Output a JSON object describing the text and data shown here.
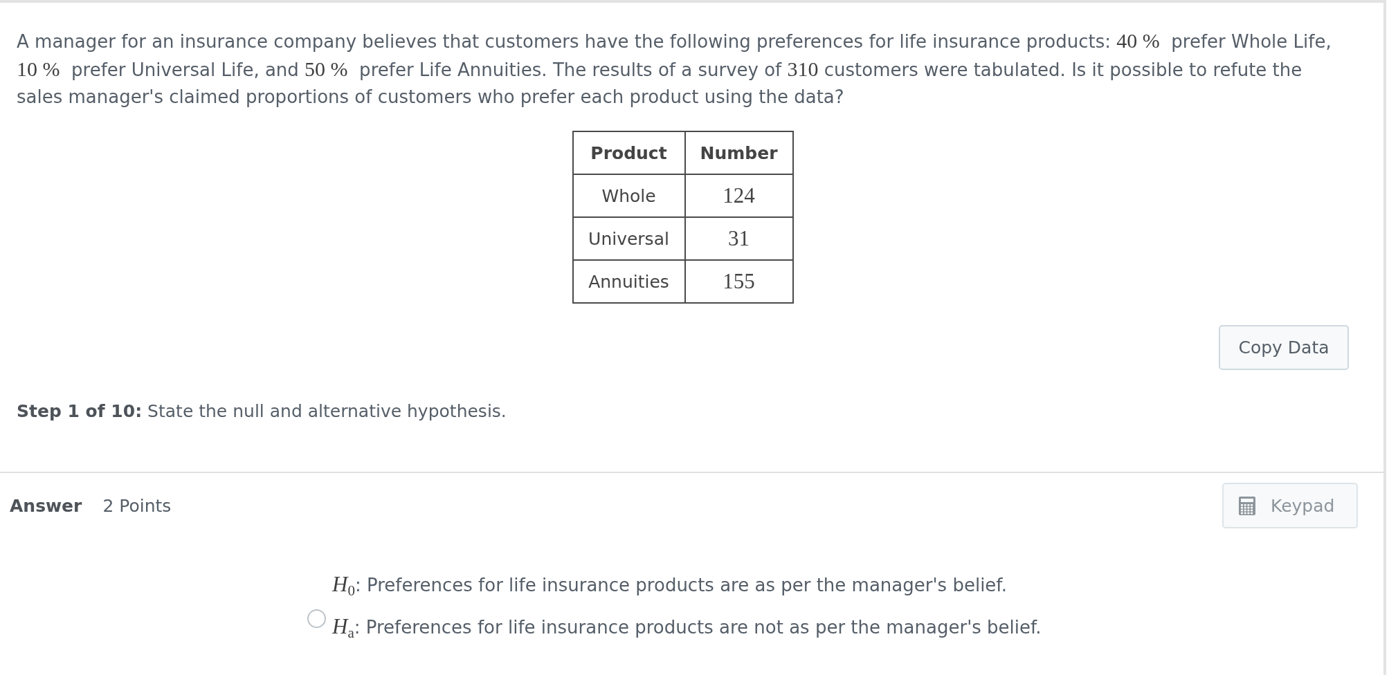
{
  "question": {
    "segments": [
      {
        "kind": "text",
        "text": "A manager for an insurance company believes that customers have the following preferences for life insurance products: "
      },
      {
        "kind": "math",
        "text": "40 %"
      },
      {
        "kind": "text",
        "text": "  prefer Whole Life, "
      },
      {
        "kind": "math",
        "text": "10 %"
      },
      {
        "kind": "text",
        "text": "  prefer Universal Life, and "
      },
      {
        "kind": "math",
        "text": "50 %"
      },
      {
        "kind": "text",
        "text": "  prefer Life Annuities. The results of a survey of "
      },
      {
        "kind": "math",
        "text": "310"
      },
      {
        "kind": "text",
        "text": " customers were tabulated. Is it possible to refute the sales manager's claimed proportions of customers who prefer each product using the data?"
      }
    ]
  },
  "table": {
    "columns": [
      "Product",
      "Number"
    ],
    "rows": [
      [
        "Whole",
        "124"
      ],
      [
        "Universal",
        "31"
      ],
      [
        "Annuities",
        "155"
      ]
    ]
  },
  "copy_button": "Copy Data",
  "step": "**Step 1 of 10:** State the null and alternative hypothesis.",
  "answer": {
    "label": "Answer",
    "points": "2 Points",
    "keypad_button": "Keypad"
  },
  "options": [
    {
      "selected": false,
      "lines": [
        {
          "symbol": "*H*$_{0}$",
          "text": ": Preferences for life insurance products are as per the manager's belief."
        },
        {
          "symbol": "*H*$_{a}$",
          "text": ": Preferences for life insurance products are not as per the manager's belief."
        }
      ]
    }
  ]
}
